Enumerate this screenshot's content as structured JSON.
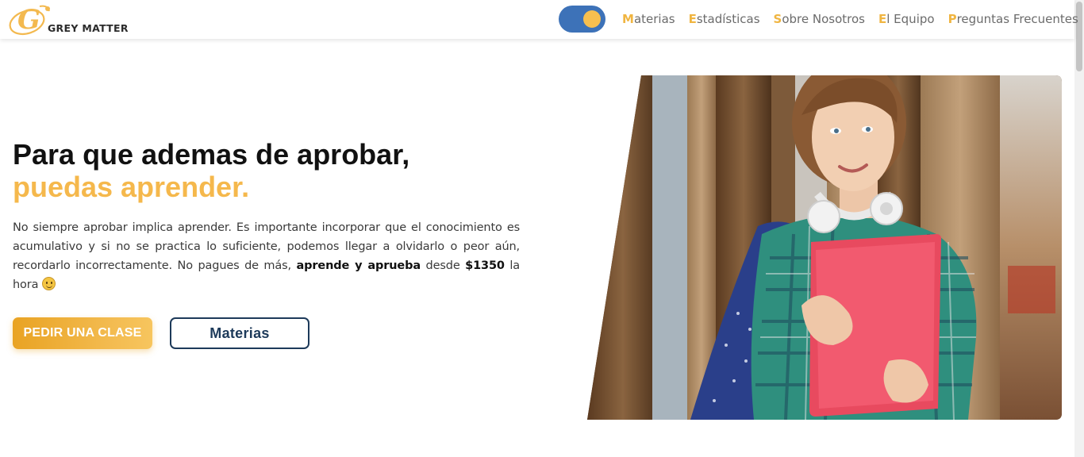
{
  "brand": {
    "name": "GREY MATTER",
    "logo_letter": "G"
  },
  "theme_toggle": {
    "state": "on"
  },
  "nav": {
    "items": [
      {
        "first": "M",
        "rest": "aterias"
      },
      {
        "first": "E",
        "rest": "stadísticas"
      },
      {
        "first": "S",
        "rest": "obre Nosotros"
      },
      {
        "first": "E",
        "rest": "l Equipo"
      },
      {
        "first": "P",
        "rest": "reguntas Frecuentes"
      }
    ]
  },
  "hero": {
    "title_line1": "Para que ademas de aprobar,",
    "title_line2": "puedas aprender.",
    "desc_part1": "No siempre aprobar implica aprender. Es importante incorporar que el conocimiento es acumulativo y si no se practica lo suficiente, podemos llegar a olvidarlo o peor aún, recordarlo incorrectamente. No pagues de más,",
    "desc_bold1": "aprende y aprueba",
    "desc_part2": "desde",
    "desc_bold2": "$1350",
    "desc_part3": "la hora",
    "emoji": "smiling-face",
    "primary_button": "PEDIR UNA CLASE",
    "secondary_button": "Materias"
  },
  "colors": {
    "accent": "#f5b84c",
    "toggle": "#3d72b8",
    "button_gradient_start": "#e9a323",
    "button_gradient_end": "#f7c55e",
    "secondary_border": "#1d3a5a"
  }
}
